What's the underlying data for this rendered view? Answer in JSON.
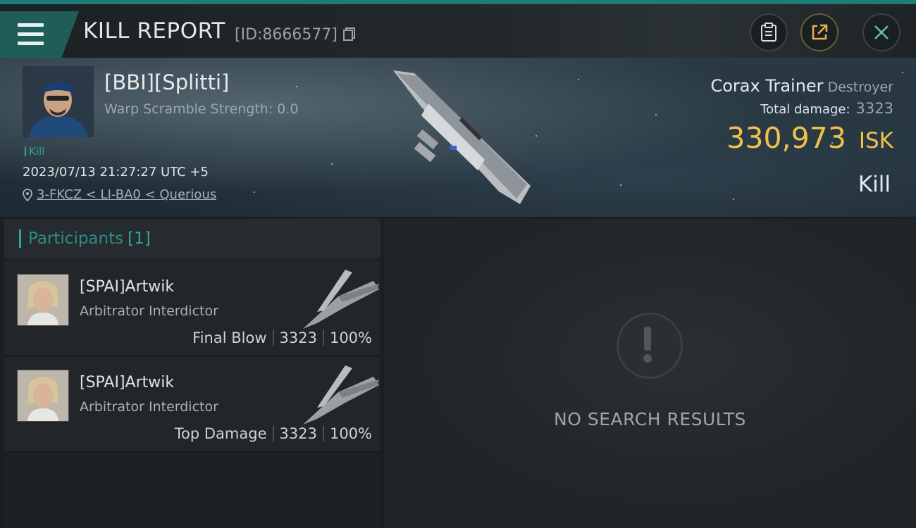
{
  "header": {
    "title": "KILL REPORT",
    "id_label": "[ID:8666577]"
  },
  "victim": {
    "name": "[BBI][Splitti]",
    "warp_scramble": "Warp Scramble Strength: 0.0",
    "tag": "Kill",
    "timestamp": "2023/07/13 21:27:27 UTC +5",
    "location": "3-FKCZ < LI-BA0 < Querious",
    "ship_name": "Corax Trainer",
    "ship_class": "Destroyer",
    "damage_label": "Total damage:",
    "damage_value": "3323",
    "isk_value": "330,973",
    "isk_unit": "ISK",
    "result": "Kill"
  },
  "participants": {
    "title": "Participants",
    "count": "[1]",
    "rows": [
      {
        "name": "[SPAI]Artwik",
        "ship": "Arbitrator Interdictor",
        "role": "Final Blow",
        "damage": "3323",
        "percent": "100%"
      },
      {
        "name": "[SPAI]Artwik",
        "ship": "Arbitrator Interdictor",
        "role": "Top Damage",
        "damage": "3323",
        "percent": "100%"
      }
    ]
  },
  "right_panel": {
    "empty_text": "NO SEARCH RESULTS"
  },
  "colors": {
    "accent": "#2fa59b",
    "isk": "#f0c24a"
  }
}
